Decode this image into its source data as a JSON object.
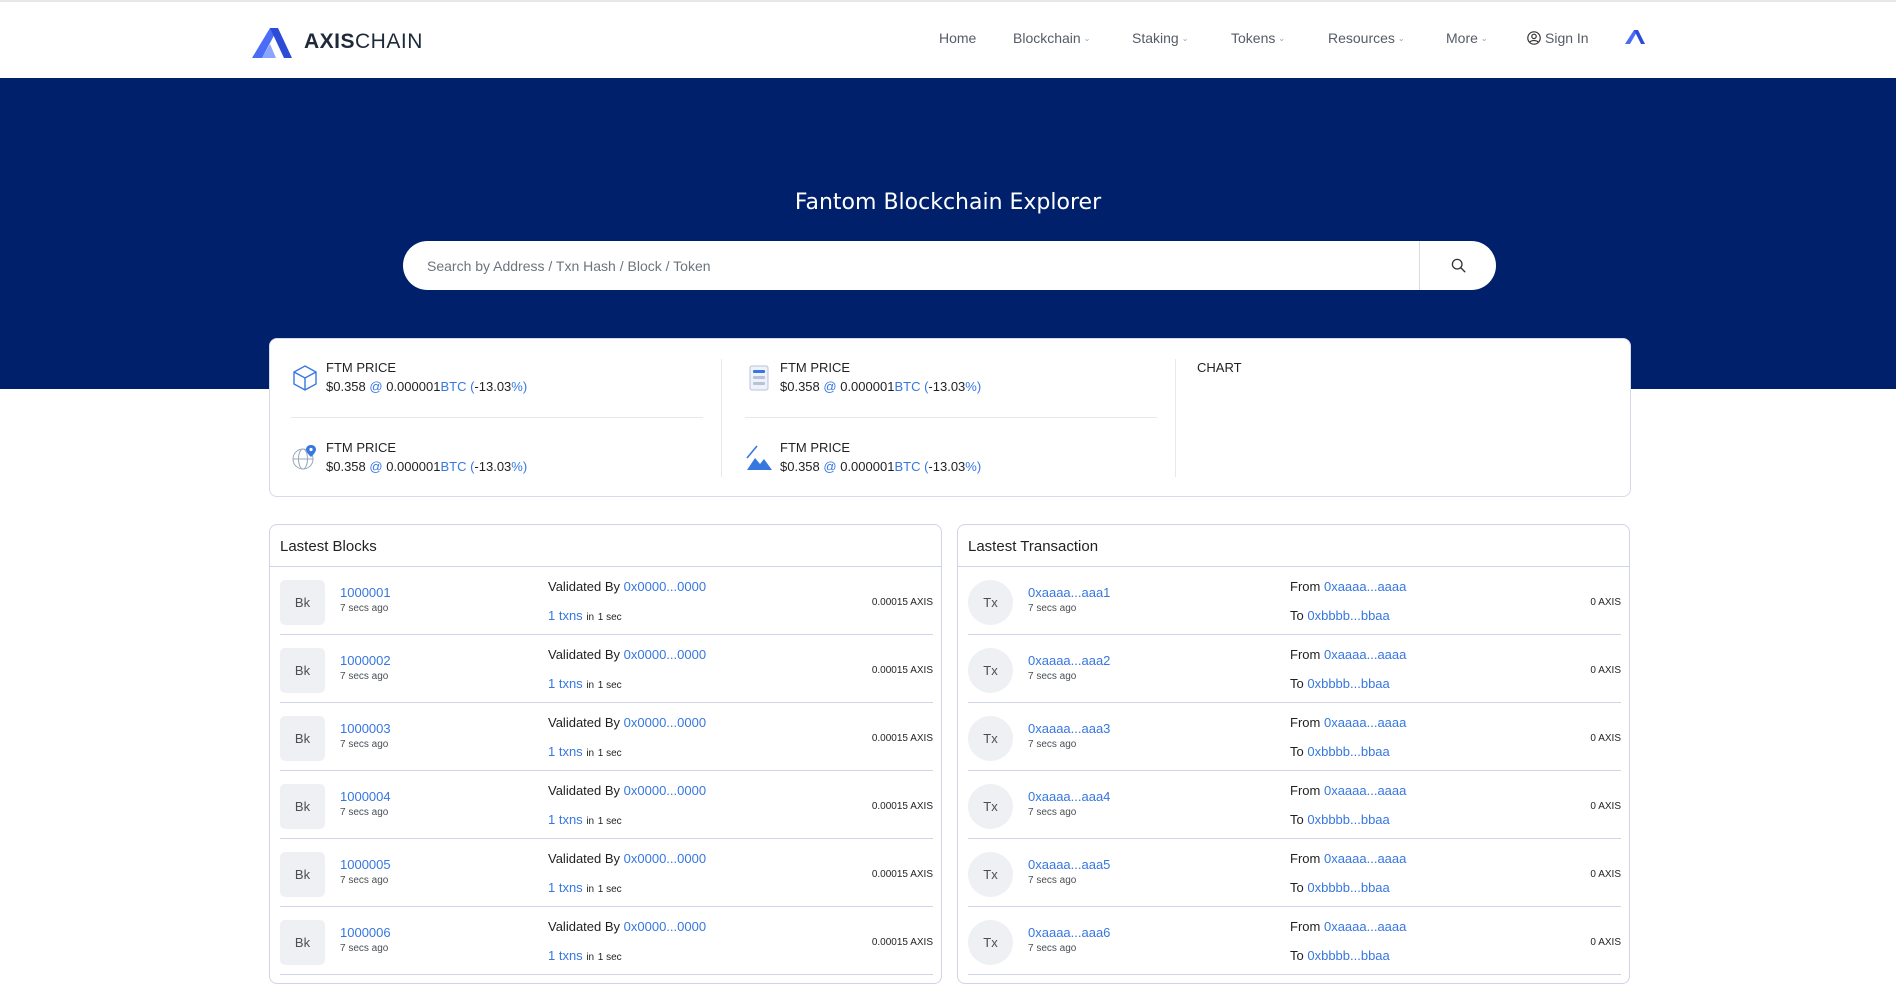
{
  "brand": {
    "bold": "AXIS",
    "light": "CHAIN"
  },
  "nav": {
    "home": "Home",
    "blockchain": "Blockchain",
    "staking": "Staking",
    "tokens": "Tokens",
    "resources": "Resources",
    "more": "More",
    "signin": "Sign In"
  },
  "hero": {
    "title": "Fantom Blockchain Explorer",
    "search_placeholder": "Search by Address / Txn Hash / Block / Token"
  },
  "stats": {
    "items": [
      {
        "label": "FTM PRICE",
        "price": "$0.358",
        "at": "@",
        "btc": "0.000001",
        "btc_unit": "BTC",
        "change_open": "(",
        "change": "-13.03",
        "change_close": "%)"
      },
      {
        "label": "FTM PRICE",
        "price": "$0.358",
        "at": "@",
        "btc": "0.000001",
        "btc_unit": "BTC",
        "change_open": "(",
        "change": "-13.03",
        "change_close": "%)"
      },
      {
        "label": "FTM PRICE",
        "price": "$0.358",
        "at": "@",
        "btc": "0.000001",
        "btc_unit": "BTC",
        "change_open": "(",
        "change": "-13.03",
        "change_close": "%)"
      },
      {
        "label": "FTM PRICE",
        "price": "$0.358",
        "at": "@",
        "btc": "0.000001",
        "btc_unit": "BTC",
        "change_open": "(",
        "change": "-13.03",
        "change_close": "%)"
      }
    ],
    "chart_label": "CHART"
  },
  "blocks": {
    "title": "Lastest Blocks",
    "rows": [
      {
        "badge": "Bk",
        "id": "1000001",
        "time": "7 secs ago",
        "validated_label": "Validated By",
        "validator": "0x0000...0000",
        "txns": "1 txns",
        "in_label": "in",
        "duration": "1 sec",
        "amount": "0.00015 AXIS"
      },
      {
        "badge": "Bk",
        "id": "1000002",
        "time": "7 secs ago",
        "validated_label": "Validated By",
        "validator": "0x0000...0000",
        "txns": "1 txns",
        "in_label": "in",
        "duration": "1 sec",
        "amount": "0.00015 AXIS"
      },
      {
        "badge": "Bk",
        "id": "1000003",
        "time": "7 secs ago",
        "validated_label": "Validated By",
        "validator": "0x0000...0000",
        "txns": "1 txns",
        "in_label": "in",
        "duration": "1 sec",
        "amount": "0.00015 AXIS"
      },
      {
        "badge": "Bk",
        "id": "1000004",
        "time": "7 secs ago",
        "validated_label": "Validated By",
        "validator": "0x0000...0000",
        "txns": "1 txns",
        "in_label": "in",
        "duration": "1 sec",
        "amount": "0.00015 AXIS"
      },
      {
        "badge": "Bk",
        "id": "1000005",
        "time": "7 secs ago",
        "validated_label": "Validated By",
        "validator": "0x0000...0000",
        "txns": "1 txns",
        "in_label": "in",
        "duration": "1 sec",
        "amount": "0.00015 AXIS"
      },
      {
        "badge": "Bk",
        "id": "1000006",
        "time": "7 secs ago",
        "validated_label": "Validated By",
        "validator": "0x0000...0000",
        "txns": "1 txns",
        "in_label": "in",
        "duration": "1 sec",
        "amount": "0.00015 AXIS"
      }
    ]
  },
  "transactions": {
    "title": "Lastest Transaction",
    "rows": [
      {
        "badge": "Tx",
        "hash": "0xaaaa...aaa1",
        "time": "7 secs ago",
        "from_label": "From",
        "from": "0xaaaa...aaaa",
        "to_label": "To",
        "to": "0xbbbb...bbaa",
        "amount": "0 AXIS"
      },
      {
        "badge": "Tx",
        "hash": "0xaaaa...aaa2",
        "time": "7 secs ago",
        "from_label": "From",
        "from": "0xaaaa...aaaa",
        "to_label": "To",
        "to": "0xbbbb...bbaa",
        "amount": "0 AXIS"
      },
      {
        "badge": "Tx",
        "hash": "0xaaaa...aaa3",
        "time": "7 secs ago",
        "from_label": "From",
        "from": "0xaaaa...aaaa",
        "to_label": "To",
        "to": "0xbbbb...bbaa",
        "amount": "0 AXIS"
      },
      {
        "badge": "Tx",
        "hash": "0xaaaa...aaa4",
        "time": "7 secs ago",
        "from_label": "From",
        "from": "0xaaaa...aaaa",
        "to_label": "To",
        "to": "0xbbbb...bbaa",
        "amount": "0 AXIS"
      },
      {
        "badge": "Tx",
        "hash": "0xaaaa...aaa5",
        "time": "7 secs ago",
        "from_label": "From",
        "from": "0xaaaa...aaaa",
        "to_label": "To",
        "to": "0xbbbb...bbaa",
        "amount": "0 AXIS"
      },
      {
        "badge": "Tx",
        "hash": "0xaaaa...aaa6",
        "time": "7 secs ago",
        "from_label": "From",
        "from": "0xaaaa...aaaa",
        "to_label": "To",
        "to": "0xbbbb...bbaa",
        "amount": "0 AXIS"
      }
    ]
  },
  "icons": {
    "logo": "axischain-logo-icon",
    "user": "user-circle-icon",
    "search": "search-icon",
    "stat1": "cube-icon",
    "stat2": "server-icon",
    "stat3": "globe-pin-icon",
    "stat4": "mountain-chart-icon"
  },
  "colors": {
    "hero_bg": "#00206b",
    "link": "#3677e0",
    "border": "#cfd4ea"
  }
}
